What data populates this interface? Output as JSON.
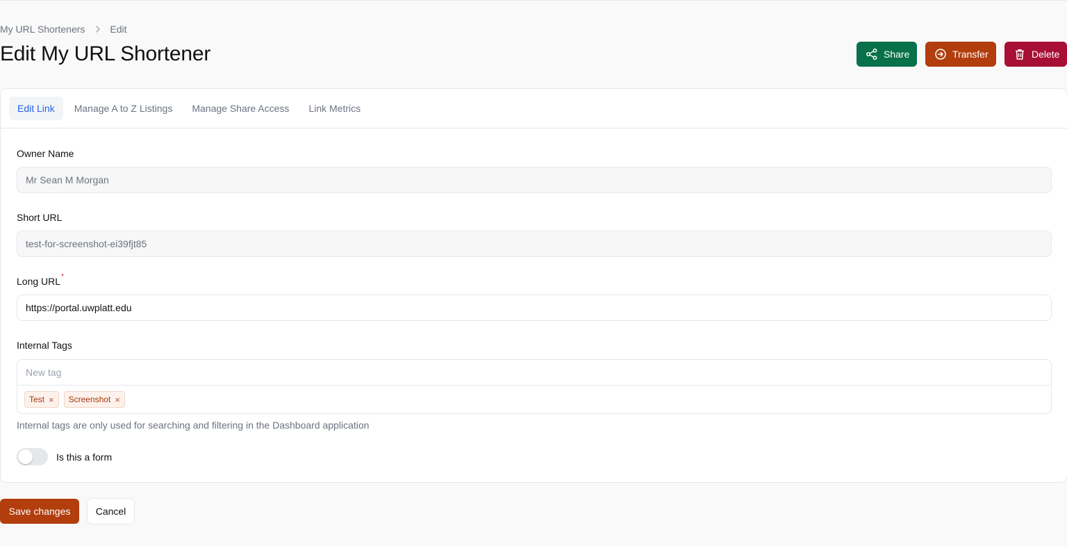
{
  "breadcrumb": {
    "parent": "My URL Shorteners",
    "current": "Edit"
  },
  "page": {
    "title": "Edit My URL Shortener"
  },
  "actions": {
    "share": "Share",
    "transfer": "Transfer",
    "delete": "Delete"
  },
  "tabs": [
    {
      "label": "Edit Link",
      "active": true
    },
    {
      "label": "Manage A to Z Listings"
    },
    {
      "label": "Manage Share Access"
    },
    {
      "label": "Link Metrics"
    }
  ],
  "form": {
    "owner_name": {
      "label": "Owner Name",
      "value": "Mr Sean M Morgan"
    },
    "short_url": {
      "label": "Short URL",
      "value": "test-for-screenshot-ei39fjt85"
    },
    "long_url": {
      "label": "Long URL",
      "required_mark": "*",
      "value": "https://portal.uwplatt.edu"
    },
    "internal_tags": {
      "label": "Internal Tags",
      "placeholder": "New tag",
      "tags": [
        "Test",
        "Screenshot"
      ],
      "remove_glyph": "×",
      "helper": "Internal tags are only used for searching and filtering in the Dashboard application"
    },
    "is_form": {
      "label": "Is this a form",
      "checked": false
    }
  },
  "footer": {
    "save": "Save changes",
    "cancel": "Cancel"
  },
  "icons": {
    "breadcrumb_sep": "chevron-right-icon",
    "share": "share-icon",
    "transfer": "arrow-right-circle-icon",
    "delete": "trash-icon"
  },
  "colors": {
    "share": "#08704a",
    "transfer": "#b23d0d",
    "delete": "#a80f35",
    "save": "#b23d0d",
    "active_tab": "#2563eb"
  }
}
